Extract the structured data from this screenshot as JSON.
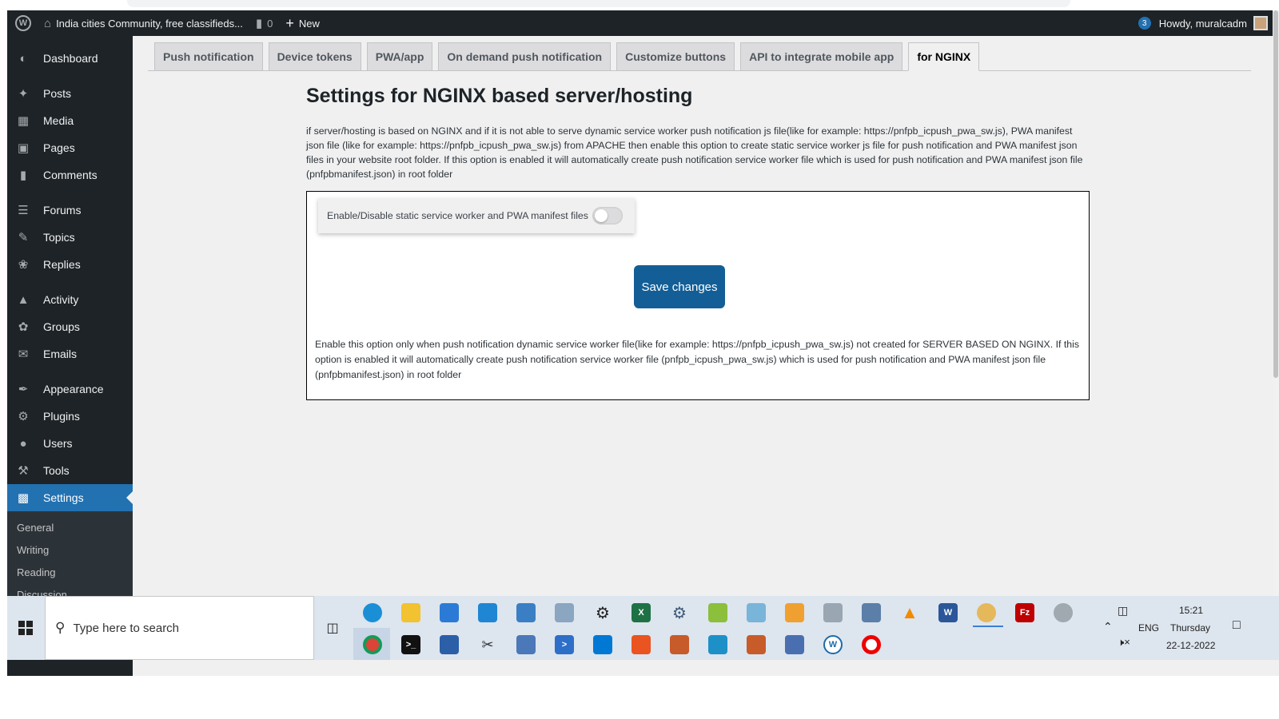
{
  "adminbar": {
    "site_name": "India cities Community, free classifieds...",
    "comments_count": "0",
    "new_label": "New",
    "notification_count": "3",
    "howdy": "Howdy, muralcadm"
  },
  "sidebar": {
    "items": [
      {
        "label": "Dashboard",
        "icon": "dashboard-icon"
      },
      {
        "label": "Posts",
        "icon": "pin-icon"
      },
      {
        "label": "Media",
        "icon": "media-icon"
      },
      {
        "label": "Pages",
        "icon": "pages-icon"
      },
      {
        "label": "Comments",
        "icon": "comment-icon"
      },
      {
        "label": "Forums",
        "icon": "forums-icon"
      },
      {
        "label": "Topics",
        "icon": "topics-icon"
      },
      {
        "label": "Replies",
        "icon": "replies-icon"
      },
      {
        "label": "Activity",
        "icon": "activity-icon"
      },
      {
        "label": "Groups",
        "icon": "groups-icon"
      },
      {
        "label": "Emails",
        "icon": "email-icon"
      },
      {
        "label": "Appearance",
        "icon": "brush-icon"
      },
      {
        "label": "Plugins",
        "icon": "plugin-icon"
      },
      {
        "label": "Users",
        "icon": "user-icon"
      },
      {
        "label": "Tools",
        "icon": "wrench-icon"
      },
      {
        "label": "Settings",
        "icon": "settings-icon"
      }
    ],
    "submenu": [
      "General",
      "Writing",
      "Reading",
      "Discussion"
    ]
  },
  "tabs": [
    "Push notification",
    "Device tokens",
    "PWA/app",
    "On demand push notification",
    "Customize buttons",
    "API to integrate mobile app",
    "for NGINX"
  ],
  "active_tab": "for NGINX",
  "main": {
    "title": "Settings for NGINX based server/hosting",
    "intro": "if server/hosting is based on NGINX and if it is not able to serve dynamic service worker push notification js file(like for example: https://pnfpb_icpush_pwa_sw.js), PWA manifest json file (like for example: https://pnfpb_icpush_pwa_sw.js) from APACHE then enable this option to create static service worker js file for push notification and PWA manifest json files in your website root folder. If this option is enabled it will automatically create push notification service worker file which is used for push notification and PWA manifest json file (pnfpbmanifest.json) in root folder",
    "toggle_label": "Enable/Disable static service worker and PWA manifest files",
    "toggle_on": false,
    "save_label": "Save changes",
    "note": "Enable this option only when push notification dynamic service worker file(like for example: https://pnfpb_icpush_pwa_sw.js) not created for SERVER BASED ON NGINX. If this option is enabled it will automatically create push notification service worker file (pnfpb_icpush_pwa_sw.js) which is used for push notification and PWA manifest json file (pnfpbmanifest.json) in root folder"
  },
  "taskbar": {
    "search_placeholder": "Type here to search",
    "language": "ENG",
    "time": "15:21",
    "day": "Thursday",
    "date": "22-12-2022"
  },
  "colors": {
    "admin_dark": "#1d2327",
    "accent": "#2271b1",
    "save_button": "#135e96"
  }
}
